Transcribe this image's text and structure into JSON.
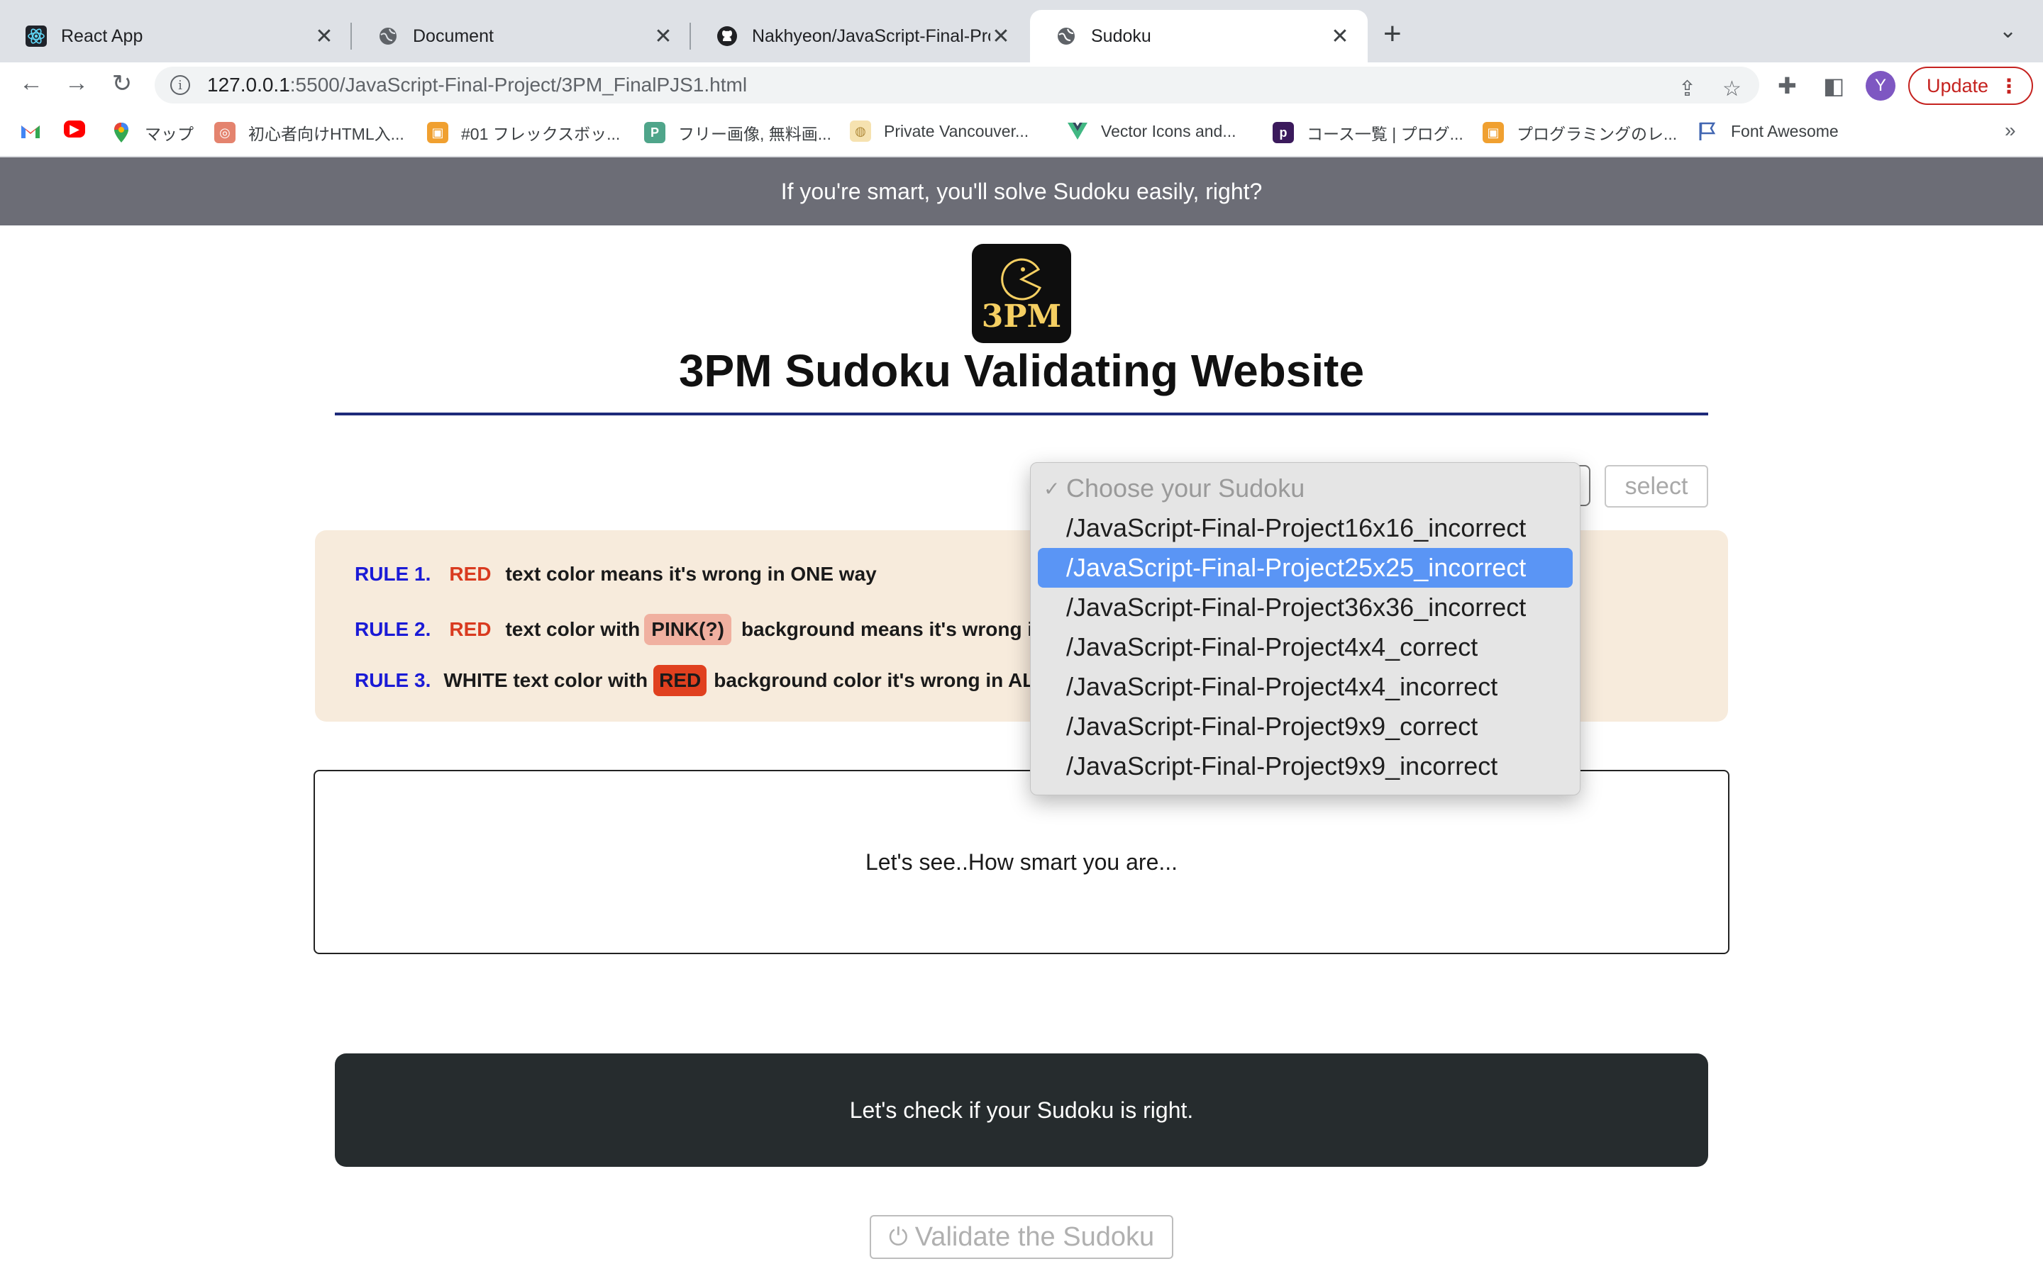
{
  "browser": {
    "tabs": [
      {
        "title": "React App",
        "icon": "react-icon",
        "active": false
      },
      {
        "title": "Document",
        "icon": "globe-icon",
        "active": false
      },
      {
        "title": "Nakhyeon/JavaScript-Final-Pro",
        "icon": "github-icon",
        "active": false
      },
      {
        "title": "Sudoku",
        "icon": "globe-icon",
        "active": true
      }
    ],
    "url_host": "127.0.0.1",
    "url_path": ":5500/JavaScript-Final-Project/3PM_FinalPJS1.html",
    "profile_initial": "Y",
    "update_label": "Update",
    "bookmarks": [
      {
        "label": "",
        "icon": "gmail-icon"
      },
      {
        "label": "",
        "icon": "youtube-icon"
      },
      {
        "label": "マップ",
        "icon": "maps-icon"
      },
      {
        "label": "初心者向けHTML入...",
        "icon": "ubuntu-icon"
      },
      {
        "label": "#01 フレックスボッ...",
        "icon": "box-icon"
      },
      {
        "label": "フリー画像, 無料画...",
        "icon": "pixabay-icon"
      },
      {
        "label": "Private Vancouver...",
        "icon": "site-icon"
      },
      {
        "label": "Vector Icons and...",
        "icon": "vue-icon"
      },
      {
        "label": "コース一覧 | プログ...",
        "icon": "progate-icon"
      },
      {
        "label": "プログラミングのレ...",
        "icon": "box-icon"
      },
      {
        "label": "Font Awesome",
        "icon": "flag-icon"
      }
    ]
  },
  "page": {
    "banner_text": "If you're smart, you'll solve Sudoku easily, right?",
    "logo_text": "3PM",
    "title": "3PM Sudoku Validating Website",
    "select_button": "select",
    "rules": {
      "r1": {
        "label": "RULE 1.",
        "red": "RED",
        "text": "text color means it's wrong in ONE way"
      },
      "r2": {
        "label": "RULE 2.",
        "red": "RED",
        "text_a": "text color with",
        "pink": "PINK(?)",
        "text_b": "background means it's wrong in T"
      },
      "r3": {
        "label": "RULE 3.",
        "text_a": "WHITE text color with",
        "redbg": "RED",
        "text_b": "background color it's wrong in ALL"
      }
    },
    "result_text": "Let's see..How smart you are...",
    "check_text": "Let's check if your Sudoku is right.",
    "validate_label": "Validate the Sudoku"
  },
  "dropdown": {
    "placeholder": "Choose your Sudoku",
    "options": [
      "/JavaScript-Final-Project16x16_incorrect",
      "/JavaScript-Final-Project25x25_incorrect",
      "/JavaScript-Final-Project36x36_incorrect",
      "/JavaScript-Final-Project4x4_correct",
      "/JavaScript-Final-Project4x4_incorrect",
      "/JavaScript-Final-Project9x9_correct",
      "/JavaScript-Final-Project9x9_incorrect"
    ],
    "highlighted_index": 1
  },
  "colors": {
    "banner": "#6c6d76",
    "rule_label": "#1a1ad6",
    "red": "#d93a1f",
    "highlight": "#5a95f5",
    "check_bg": "#262c2e"
  }
}
